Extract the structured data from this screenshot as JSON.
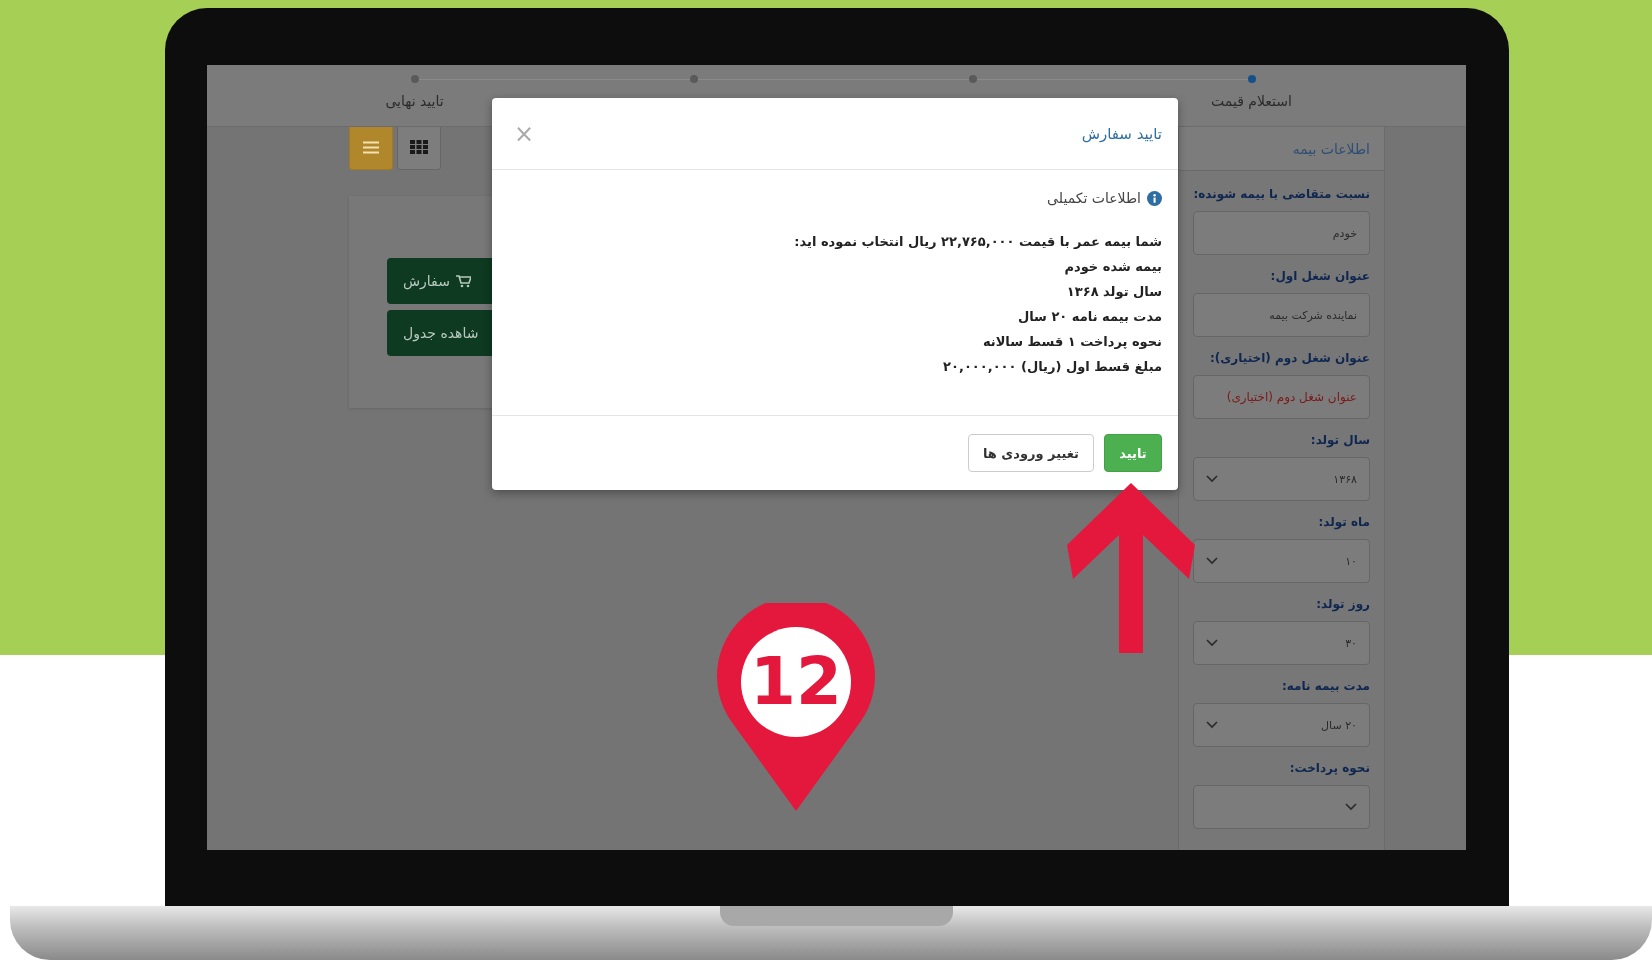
{
  "stepper": [
    {
      "label": "استعلام قیمت",
      "selected": true
    },
    {
      "selected": false
    },
    {
      "selected": false
    },
    {
      "label": "تایید نهایی",
      "selected": false
    }
  ],
  "view_toggle": [
    {
      "kind": "list",
      "selected": true
    },
    {
      "kind": "grid",
      "selected": false
    }
  ],
  "actions": [
    {
      "label": "سفارش",
      "kind": "cart"
    },
    {
      "label": "شاهده جدول",
      "kind": "plain"
    }
  ],
  "form": {
    "title": "اطلاعات بیمه",
    "fields": [
      {
        "label": "نسبت متقاضی با بیمه شونده:",
        "value": "خودم",
        "kind": "input"
      },
      {
        "label": "عنوان شغل اول:",
        "value": "نماینده شرکت بیمه",
        "kind": "input"
      },
      {
        "label": "عنوان شغل دوم (اختیاری):",
        "placeholder": "عنوان شغل دوم (اختیاری)",
        "kind": "input"
      },
      {
        "label": "سال تولد:",
        "value": "۱۳۶۸",
        "kind": "select"
      },
      {
        "label": "ماه تولد:",
        "value": "۱۰",
        "kind": "select"
      },
      {
        "label": "روز تولد:",
        "value": "۳۰",
        "kind": "select"
      },
      {
        "label": "مدت بیمه نامه:",
        "value": "۲۰ سال",
        "kind": "select"
      },
      {
        "label": "نحوه پرداخت:",
        "kind": "select"
      }
    ]
  },
  "modal": {
    "title": "تایید سفارش",
    "close": "×",
    "section": "اطلاعات تکمیلی",
    "lines": [
      "شما بیمه عمر با قیمت ۲۲,۷۶۵,۰۰۰ ریال انتخاب نموده اید:",
      "بیمه شده خودم",
      "سال تولد ۱۳۶۸",
      "مدت بیمه نامه ۲۰ سال",
      "نحوه پرداخت ۱ قسط سالانه",
      "مبلغ قسط اول (ریال) ۲۰,۰۰۰,۰۰۰"
    ],
    "buttons": [
      {
        "label": "تایید",
        "kind": "primary"
      },
      {
        "label": "تغییر ورودی ها",
        "kind": "default"
      }
    ]
  },
  "annotation": {
    "step_number": "12"
  }
}
